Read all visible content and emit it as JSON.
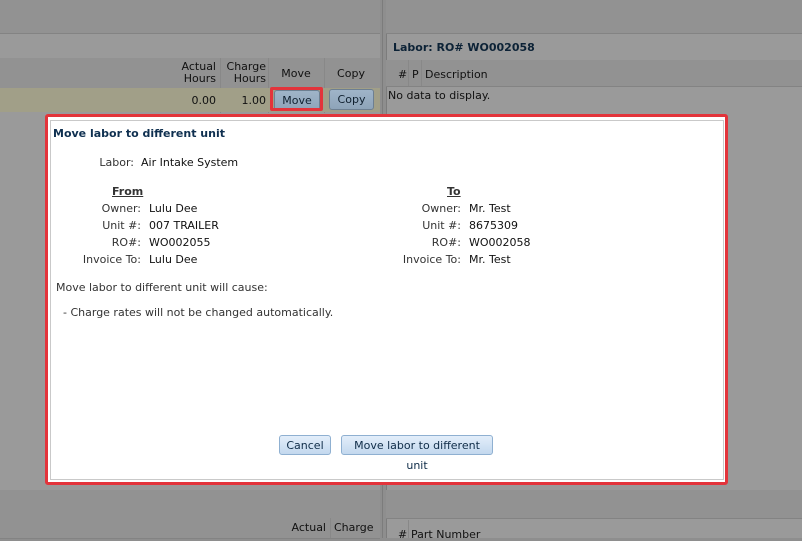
{
  "background": {
    "left_grid": {
      "headers": [
        "Actual\nHours",
        "Charge\nHours",
        "Move",
        "Copy"
      ],
      "row": {
        "actual_hours": "0.00",
        "charge_hours": "1.00",
        "move_label": "Move",
        "copy_label": "Copy"
      }
    },
    "right_panel": {
      "title": "Labor: RO# WO002058",
      "headers": [
        "#",
        "P",
        "Description"
      ],
      "empty_text": "No data to display."
    },
    "bottom_left": {
      "headers": [
        "Actual",
        "Charge"
      ]
    },
    "bottom_right": {
      "headers": [
        "#",
        "Part Number"
      ]
    }
  },
  "dialog": {
    "title": "Move labor to different unit",
    "labor_label": "Labor:",
    "labor_value": "Air Intake System",
    "from": {
      "heading": "From",
      "owner_label": "Owner:",
      "owner": "Lulu Dee",
      "unit_label": "Unit #:",
      "unit": "007 TRAILER",
      "ro_label": "RO#:",
      "ro": "WO002055",
      "invoice_label": "Invoice To:",
      "invoice": "Lulu Dee"
    },
    "to": {
      "heading": "To",
      "owner_label": "Owner:",
      "owner": "Mr. Test",
      "unit_label": "Unit #:",
      "unit": "8675309",
      "ro_label": "RO#:",
      "ro": "WO002058",
      "invoice_label": "Invoice To:",
      "invoice": "Mr. Test"
    },
    "consequence_intro": "Move labor to different unit will cause:",
    "consequences": [
      "- Charge rates will not be changed automatically."
    ],
    "cancel_label": "Cancel",
    "confirm_label": "Move labor to different unit"
  },
  "colors": {
    "highlight": "#e3343b",
    "title": "#0f3050"
  }
}
